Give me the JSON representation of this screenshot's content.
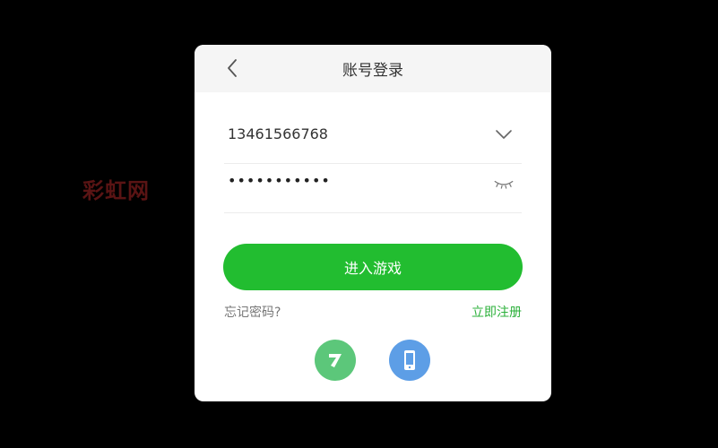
{
  "watermark": "彩虹网",
  "dialog": {
    "title": "账号登录",
    "account_value": "13461566768",
    "password_value": "•••••••••••",
    "login_label": "进入游戏",
    "forgot_label": "忘记密码?",
    "register_label": "立即注册"
  },
  "icons": {
    "back": "chevron-left-icon",
    "dropdown": "chevron-down-icon",
    "eye": "eye-closed-icon",
    "seven": "seven-logo-icon",
    "phone": "phone-icon"
  },
  "colors": {
    "primary_green": "#22bd30",
    "register_green": "#2bb03a",
    "seven_green": "#5cc77a",
    "phone_blue": "#5d9ee6"
  }
}
